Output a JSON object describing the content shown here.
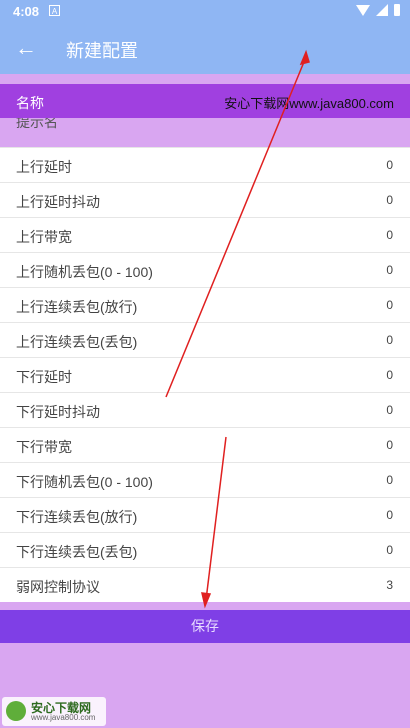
{
  "status_bar": {
    "time": "4:08",
    "a_icon": "A"
  },
  "app_bar": {
    "back_glyph": "←",
    "title": "新建配置"
  },
  "name_field": {
    "label": "名称",
    "value": "安心下载网www.java800.com"
  },
  "cut_row_label": "提示名",
  "rows": [
    {
      "label": "上行延时",
      "value": "0"
    },
    {
      "label": "上行延时抖动",
      "value": "0"
    },
    {
      "label": "上行带宽",
      "value": "0"
    },
    {
      "label": "上行随机丢包(0 - 100)",
      "value": "0"
    },
    {
      "label": "上行连续丢包(放行)",
      "value": "0"
    },
    {
      "label": "上行连续丢包(丢包)",
      "value": "0"
    },
    {
      "label": "下行延时",
      "value": "0"
    },
    {
      "label": "下行延时抖动",
      "value": "0"
    },
    {
      "label": "下行带宽",
      "value": "0"
    },
    {
      "label": "下行随机丢包(0 - 100)",
      "value": "0"
    },
    {
      "label": "下行连续丢包(放行)",
      "value": "0"
    },
    {
      "label": "下行连续丢包(丢包)",
      "value": "0"
    },
    {
      "label": "弱网控制协议",
      "value": "3"
    }
  ],
  "save_button": "保存",
  "watermark": {
    "title": "安心下载网",
    "subtitle": "www.java800.com"
  },
  "colors": {
    "app_bar": "#8fb6f3",
    "name_bar": "#a040e0",
    "save_bar": "#7f3fe6",
    "arrow": "#e02020"
  }
}
